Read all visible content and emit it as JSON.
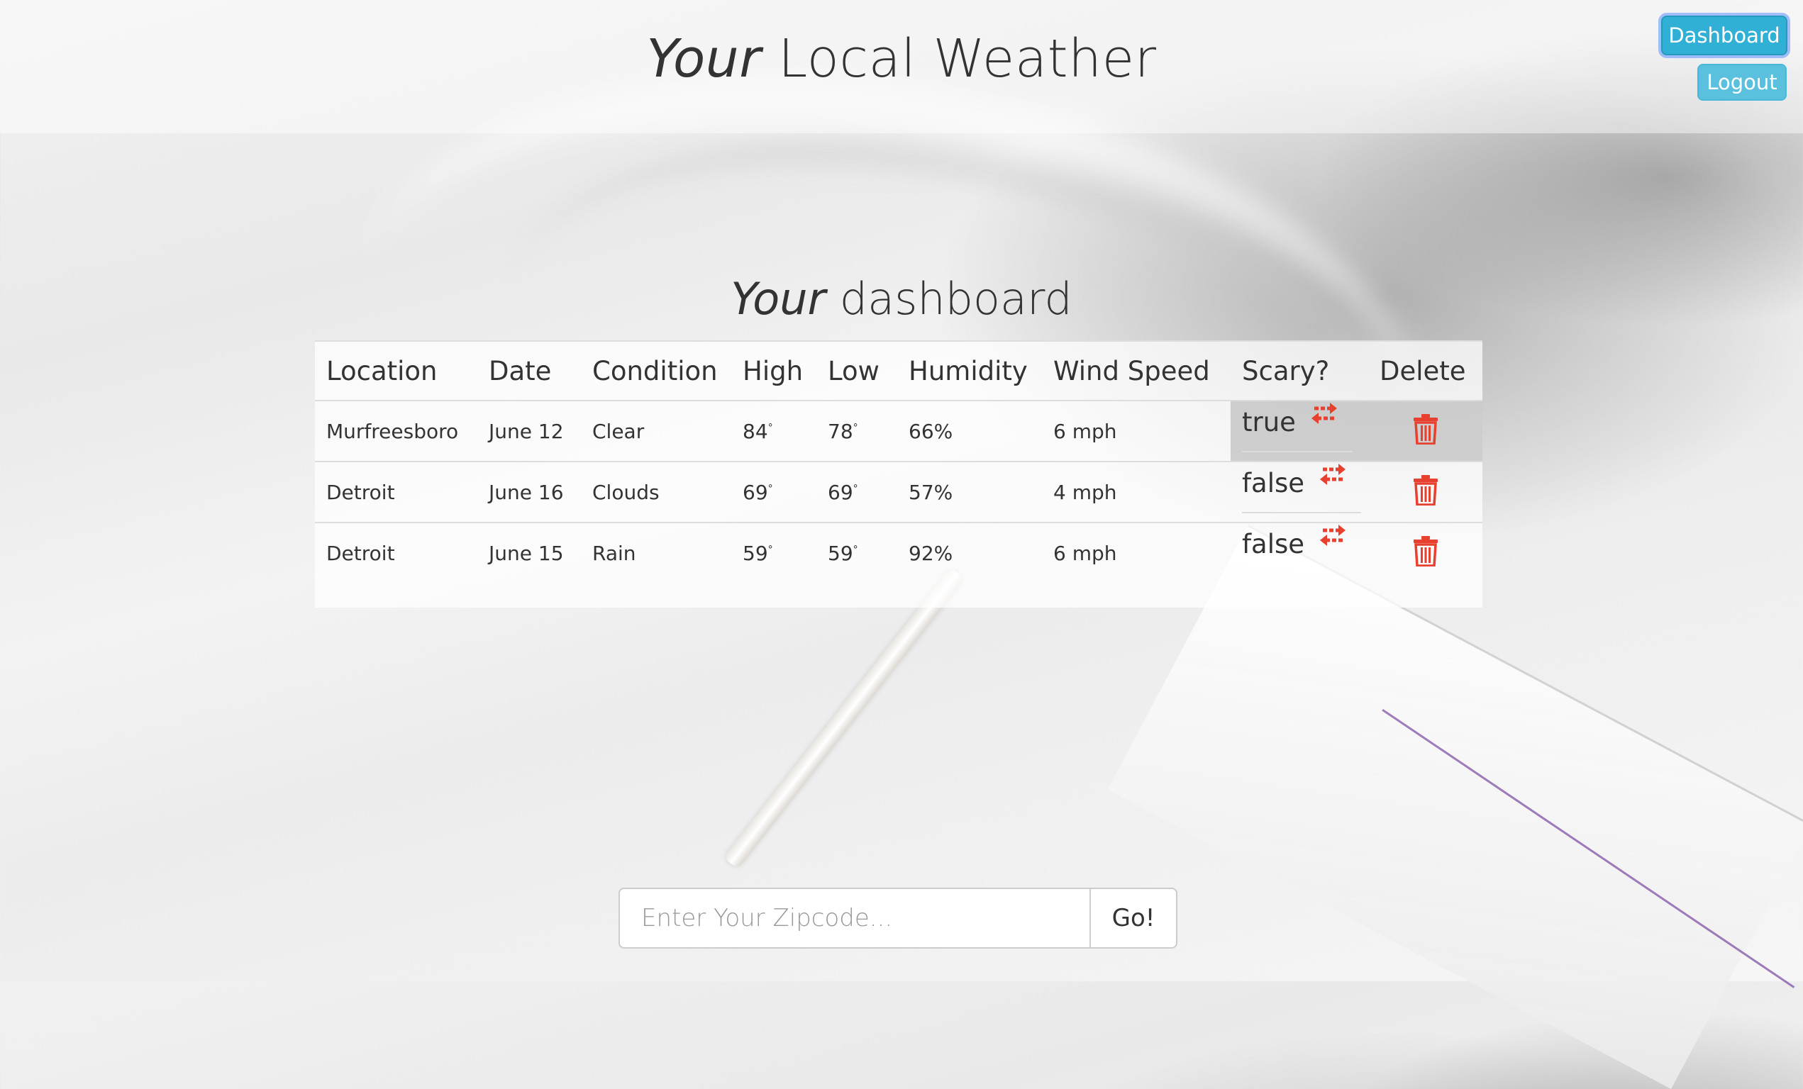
{
  "header": {
    "title_em": "Your",
    "title_rest": " Local Weather",
    "nav": {
      "dashboard_label": "Dashboard",
      "logout_label": "Logout"
    }
  },
  "dashboard": {
    "title_em": "Your",
    "title_rest": " dashboard",
    "columns": [
      "Location",
      "Date",
      "Condition",
      "High",
      "Low",
      "Humidity",
      "Wind Speed",
      "Scary?",
      "Delete"
    ],
    "rows": [
      {
        "location": "Murfreesboro",
        "date": "June 12",
        "condition": "Clear",
        "high": "84",
        "low": "78",
        "humidity": "66%",
        "wind": "6 mph",
        "scary": "true"
      },
      {
        "location": "Detroit",
        "date": "June 16",
        "condition": "Clouds",
        "high": "69",
        "low": "69",
        "humidity": "57%",
        "wind": "4 mph",
        "scary": "false"
      },
      {
        "location": "Detroit",
        "date": "June 15",
        "condition": "Rain",
        "high": "59",
        "low": "59",
        "humidity": "92%",
        "wind": "6 mph",
        "scary": "false"
      }
    ],
    "degree_symbol": "°",
    "icons": {
      "toggle": "swap-arrows-icon",
      "delete": "trash-icon"
    },
    "accent_color": "#e8402f"
  },
  "zip_form": {
    "placeholder": "Enter Your Zipcode...",
    "button_label": "Go!"
  },
  "colors": {
    "nav_button": "#5bc0de",
    "nav_button_active": "#31b0d5",
    "icon_red": "#e8402f"
  }
}
